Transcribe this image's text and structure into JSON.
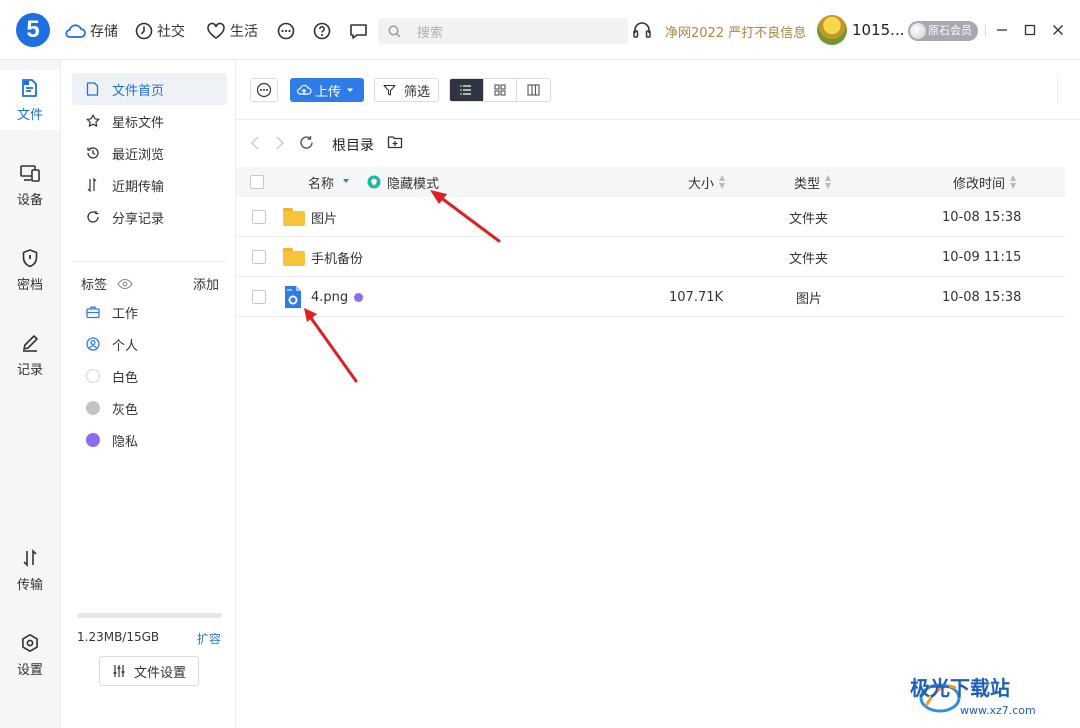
{
  "app": {
    "logo_text": "5",
    "nav": [
      {
        "label": "存储",
        "icon": "cloud-icon"
      },
      {
        "label": "社交",
        "icon": "clock-icon"
      },
      {
        "label": "生活",
        "icon": "heart-icon"
      }
    ],
    "search_placeholder": "搜索",
    "notice": "净网2022 严打不良信息",
    "username": "1015...",
    "member_badge": "原石会员"
  },
  "rail": [
    {
      "label": "文件",
      "icon": "files-icon",
      "active": true
    },
    {
      "label": "设备",
      "icon": "devices-icon"
    },
    {
      "label": "密档",
      "icon": "shield-icon"
    },
    {
      "label": "记录",
      "icon": "pen-icon"
    },
    {
      "label": "传输",
      "icon": "transfer-icon"
    },
    {
      "label": "设置",
      "icon": "settings-icon"
    }
  ],
  "sidebar": {
    "items": [
      {
        "label": "文件首页",
        "icon": "file-icon",
        "active": true
      },
      {
        "label": "星标文件",
        "icon": "star-icon"
      },
      {
        "label": "最近浏览",
        "icon": "history-icon"
      },
      {
        "label": "近期传输",
        "icon": "transfer-icon"
      },
      {
        "label": "分享记录",
        "icon": "share-icon"
      }
    ],
    "tags_title": "标签",
    "tags_add": "添加",
    "tags": [
      {
        "label": "工作",
        "icon": "briefcase-icon",
        "color": "#2f7ce8"
      },
      {
        "label": "个人",
        "icon": "person-icon",
        "color": "#2f7ce8"
      },
      {
        "label": "白色",
        "icon": "dot-icon",
        "color": "#ffffff"
      },
      {
        "label": "灰色",
        "icon": "dot-icon",
        "color": "#c4c4c4"
      },
      {
        "label": "隐私",
        "icon": "dot-icon",
        "color": "#8b6cf0"
      }
    ],
    "storage_used": "1.23MB/15GB",
    "storage_fraction": 0.0001,
    "expand_label": "扩容",
    "file_settings_label": "文件设置"
  },
  "toolbar": {
    "upload_label": "上传",
    "filter_label": "筛选"
  },
  "path": {
    "root_label": "根目录"
  },
  "table": {
    "columns": {
      "name": "名称",
      "hidden_mode": "隐藏模式",
      "size": "大小",
      "type": "类型",
      "modified": "修改时间"
    },
    "rows": [
      {
        "name": "图片",
        "kind": "folder",
        "size": "",
        "type": "文件夹",
        "modified": "10-08 15:38"
      },
      {
        "name": "手机备份",
        "kind": "folder",
        "size": "",
        "type": "文件夹",
        "modified": "10-09 11:15"
      },
      {
        "name": "4.png",
        "kind": "image",
        "size": "107.71K",
        "type": "图片",
        "modified": "10-08 15:38",
        "tag_color": "#8b6cf0"
      }
    ]
  },
  "watermark": {
    "text": "极光下载站",
    "url": "www.xz7.com"
  },
  "colors": {
    "brand_blue": "#2f7ce8",
    "annotation_red": "#e02020",
    "notice_text": "#b8823a"
  }
}
